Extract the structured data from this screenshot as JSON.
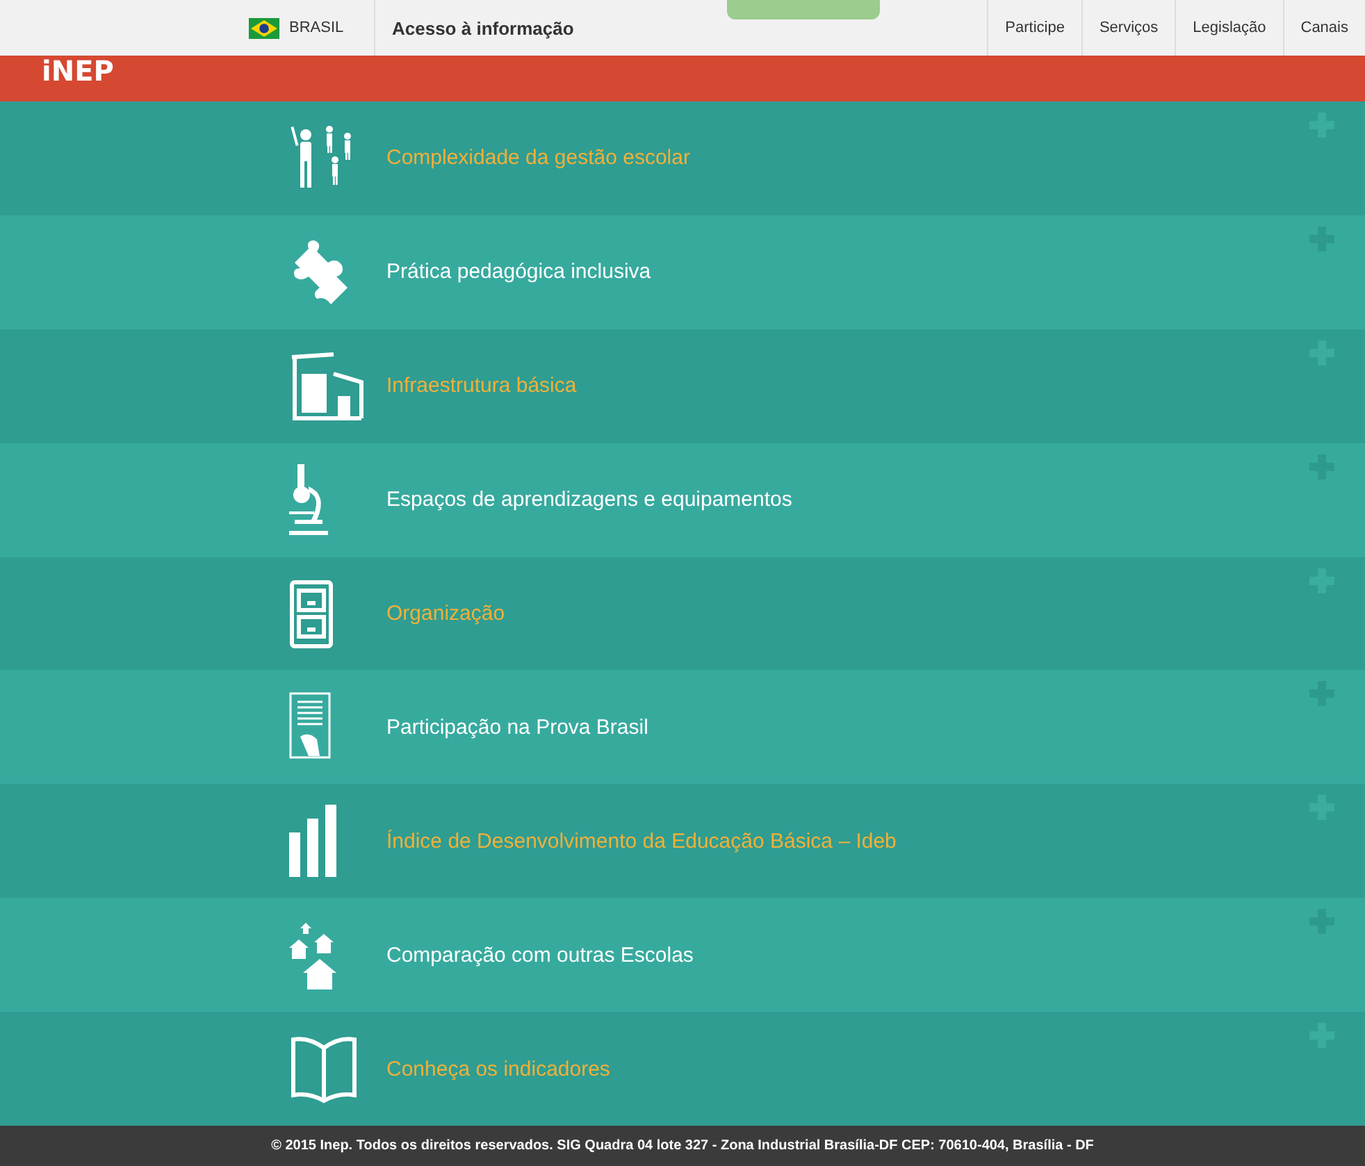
{
  "top_bar": {
    "country": "BRASIL",
    "access_link": "Acesso à informação",
    "nav": [
      "Participe",
      "Serviços",
      "Legislação",
      "Canais"
    ]
  },
  "header": {
    "logo": "iNEP"
  },
  "rows": [
    {
      "label": "Complexidade da gestão escolar",
      "kind": "dark"
    },
    {
      "label": "Prática pedagógica inclusiva",
      "kind": "light"
    },
    {
      "label": "Infraestrutura básica",
      "kind": "dark"
    },
    {
      "label": "Espaços de aprendizagens e equipamentos",
      "kind": "light"
    },
    {
      "label": "Organização",
      "kind": "dark"
    },
    {
      "label": "Participação na Prova Brasil",
      "kind": "light"
    },
    {
      "label": "Índice de Desenvolvimento da Educação Básica – Ideb",
      "kind": "dark"
    },
    {
      "label": "Comparação com outras Escolas",
      "kind": "light"
    },
    {
      "label": "Conheça os indicadores",
      "kind": "dark"
    }
  ],
  "footer": "© 2015 Inep. Todos os direitos reservados. SIG Quadra 04 lote 327 - Zona Industrial Brasília-DF CEP: 70610-404, Brasília - DF"
}
